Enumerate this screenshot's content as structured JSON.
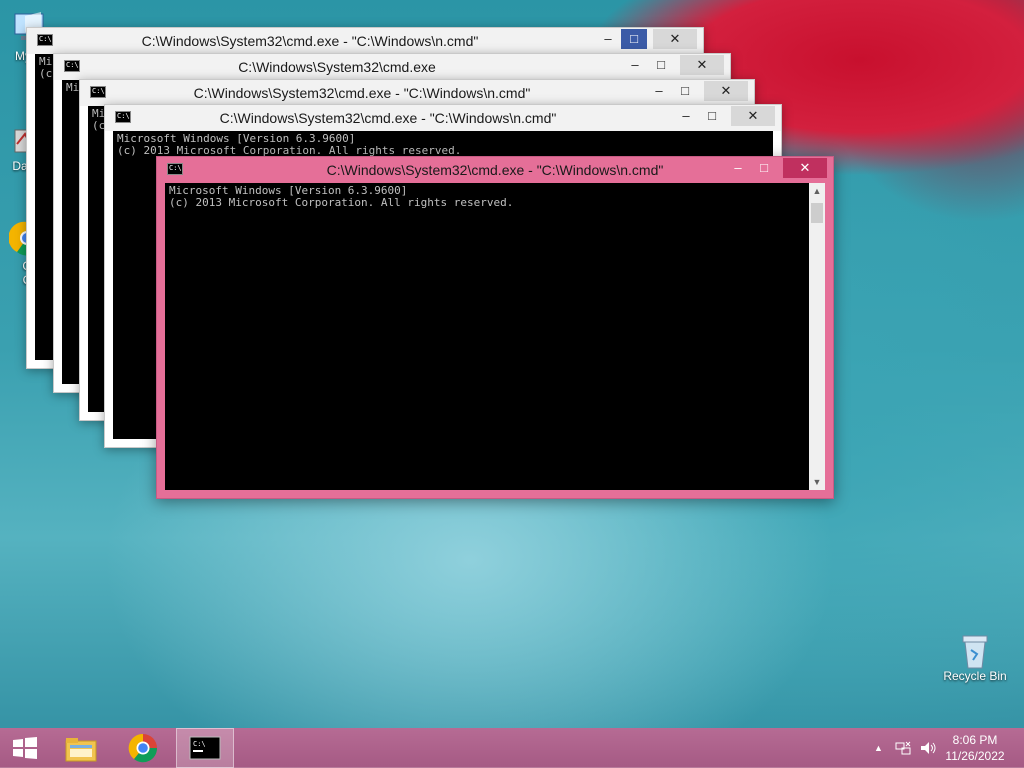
{
  "desktop": {
    "icons": [
      {
        "label": "My C"
      },
      {
        "label": "Data"
      },
      {
        "label": "G"
      },
      {
        "label": "C"
      },
      {
        "label": "Recycle Bin"
      }
    ]
  },
  "windows": [
    {
      "title": "C:\\Windows\\System32\\cmd.exe - \"C:\\Windows\\n.cmd\"",
      "console": "Mi\n(c"
    },
    {
      "title": "C:\\Windows\\System32\\cmd.exe",
      "console": "Mi"
    },
    {
      "title": "C:\\Windows\\System32\\cmd.exe - \"C:\\Windows\\n.cmd\"",
      "console": "Mi\n(c"
    },
    {
      "title": "C:\\Windows\\System32\\cmd.exe - \"C:\\Windows\\n.cmd\"",
      "console": "Microsoft Windows [Version 6.3.9600]\n(c) 2013 Microsoft Corporation. All rights reserved."
    },
    {
      "title": "C:\\Windows\\System32\\cmd.exe - \"C:\\Windows\\n.cmd\"",
      "console": "Microsoft Windows [Version 6.3.9600]\n(c) 2013 Microsoft Corporation. All rights reserved."
    }
  ],
  "window_controls": {
    "minimize": "–",
    "maximize": "□",
    "close": "✕"
  },
  "taskbar": {
    "items": [
      {
        "name": "start",
        "icon": "windows-logo"
      },
      {
        "name": "file-explorer",
        "icon": "folder"
      },
      {
        "name": "chrome",
        "icon": "chrome"
      },
      {
        "name": "command-prompt",
        "icon": "cmd",
        "active": true
      }
    ],
    "tray": {
      "time": "8:06 PM",
      "date": "11/26/2022",
      "show_hidden": "▲"
    }
  },
  "colors": {
    "accent": "#e56f98",
    "taskbar": "#b66b94"
  }
}
